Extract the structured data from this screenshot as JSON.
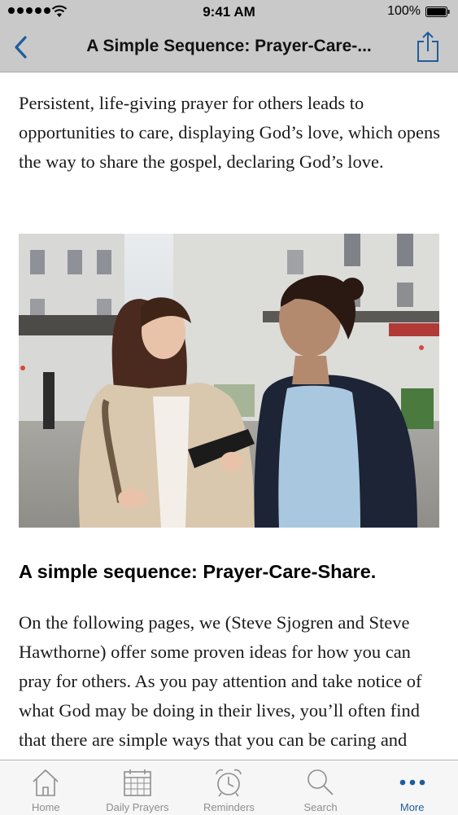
{
  "status_bar": {
    "time": "9:41 AM",
    "battery": "100%"
  },
  "nav": {
    "title": "A Simple Sequence: Prayer-Care-...",
    "back_icon": "chevron-left-icon",
    "share_icon": "share-icon"
  },
  "article": {
    "intro": "Persistent, life-giving prayer for others leads to opportunities to care, displaying God’s love, which opens the way to share the gospel, declaring God’s love.",
    "heading": "A simple sequence: Prayer-Care-Share.",
    "body": "On the following pages, we (Steve Sjogren and Steve Hawthorne) offer some proven ideas for how you can pray for others. As you pay attention and take notice of what God may be doing in their lives, you’ll often find that there are simple ways that you can be caring and kind to them."
  },
  "tabs": [
    {
      "label": "Home",
      "icon": "home-icon",
      "active": false
    },
    {
      "label": "Daily Prayers",
      "icon": "calendar-icon",
      "active": false
    },
    {
      "label": "Reminders",
      "icon": "alarm-clock-icon",
      "active": false
    },
    {
      "label": "Search",
      "icon": "search-icon",
      "active": false
    },
    {
      "label": "More",
      "icon": "more-icon",
      "active": true
    }
  ],
  "colors": {
    "bar_background": "#c9c9c9",
    "accent": "#1f5d9c",
    "tab_inactive": "#8e8e8e"
  }
}
